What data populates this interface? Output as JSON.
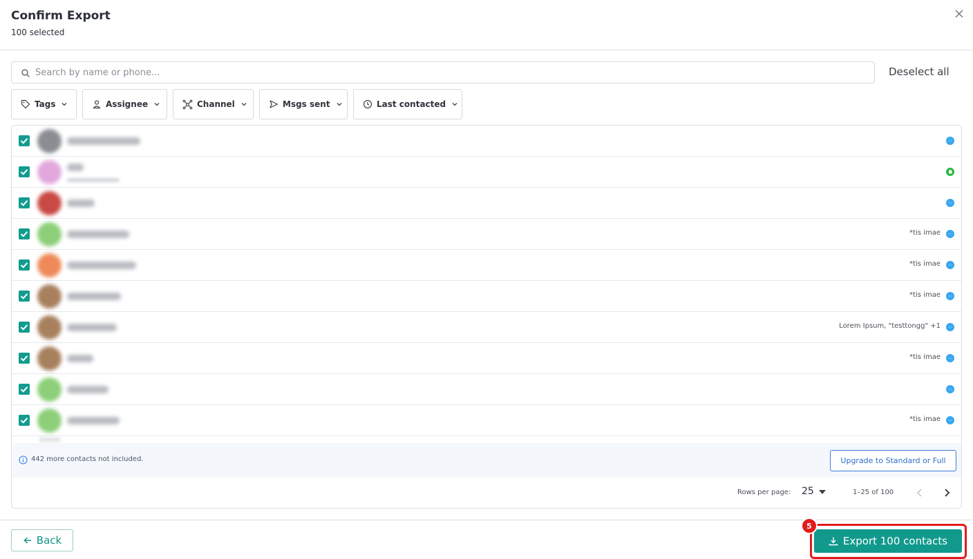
{
  "dialog": {
    "title": "Confirm Export",
    "subtitle": "100 selected"
  },
  "search": {
    "placeholder": "Search by name or phone...",
    "value": ""
  },
  "deselect_label": "Deselect all",
  "filters": [
    {
      "label": "Tags",
      "icon": "tag-icon"
    },
    {
      "label": "Assignee",
      "icon": "person-icon"
    },
    {
      "label": "Channel",
      "icon": "network-icon"
    },
    {
      "label": "Msgs sent",
      "icon": "send-icon"
    },
    {
      "label": "Last contacted",
      "icon": "clock-icon"
    }
  ],
  "rows": [
    {
      "checked": true,
      "channel": "messenger",
      "tags": ""
    },
    {
      "checked": true,
      "channel": "whatsapp",
      "tags": ""
    },
    {
      "checked": true,
      "channel": "messenger",
      "tags": ""
    },
    {
      "checked": true,
      "channel": "messenger",
      "tags": "*tis imae"
    },
    {
      "checked": true,
      "channel": "messenger",
      "tags": "*tis imae"
    },
    {
      "checked": true,
      "channel": "messenger",
      "tags": "*tis imae"
    },
    {
      "checked": true,
      "channel": "messenger",
      "tags": "Lorem Ipsum, \"testtongg\" +1"
    },
    {
      "checked": true,
      "channel": "messenger",
      "tags": "*tis imae"
    },
    {
      "checked": true,
      "channel": "messenger",
      "tags": ""
    },
    {
      "checked": true,
      "channel": "messenger",
      "tags": "*tis imae"
    }
  ],
  "notice": {
    "text": "442 more contacts not included.",
    "upgrade_label": "Upgrade to Standard or Full"
  },
  "pagination": {
    "rows_per_page_label": "Rows per page:",
    "rows_per_page": "25",
    "range": "1–25 of 100"
  },
  "footer": {
    "back_label": "Back",
    "export_label": "Export 100 contacts",
    "step_badge": "5"
  },
  "colors": {
    "accent": "#119a8c",
    "highlight": "#e21b1b",
    "link": "#2f6fcb",
    "messenger": "#3aa7f0",
    "whatsapp": "#2bb741"
  }
}
